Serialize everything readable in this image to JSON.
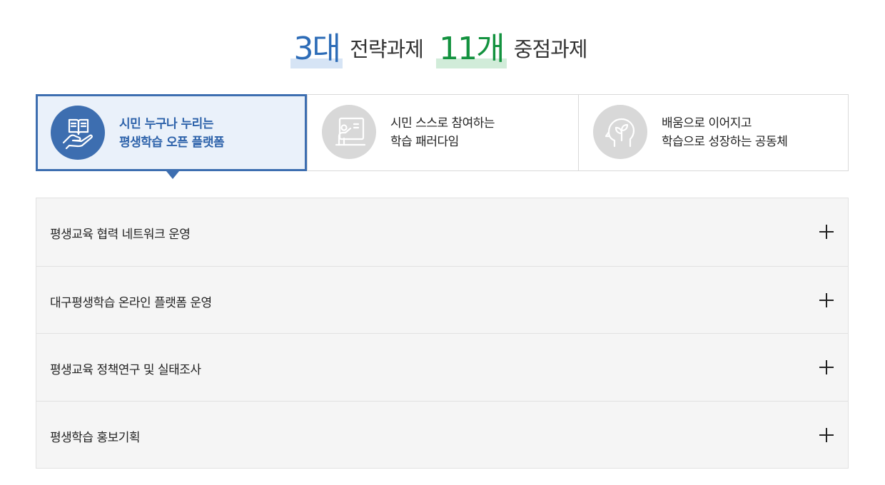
{
  "heading": {
    "num1": "3대",
    "word1": "전략과제",
    "num2": "11개",
    "word2": "중점과제"
  },
  "tabs": [
    {
      "line1": "시민 누구나 누리는",
      "line2": "평생학습 오픈 플랫폼",
      "icon": "book-hand-icon",
      "active": true
    },
    {
      "line1": "시민 스스로 참여하는",
      "line2": "학습 패러다임",
      "icon": "teacher-board-icon",
      "active": false
    },
    {
      "line1": "배움으로 이어지고",
      "line2": "학습으로 성장하는 공동체",
      "icon": "head-sprout-icon",
      "active": false
    }
  ],
  "accordion": [
    {
      "label": "평생교육 협력 네트워크 운영"
    },
    {
      "label": "대구평생학습 온라인 플랫폼 운영"
    },
    {
      "label": "평생교육 정책연구 및 실태조사"
    },
    {
      "label": "평생학습 홍보기획"
    }
  ],
  "colors": {
    "accent_blue": "#3d6eb0",
    "accent_green": "#13923f",
    "icon_inactive": "#d8d8d8"
  }
}
